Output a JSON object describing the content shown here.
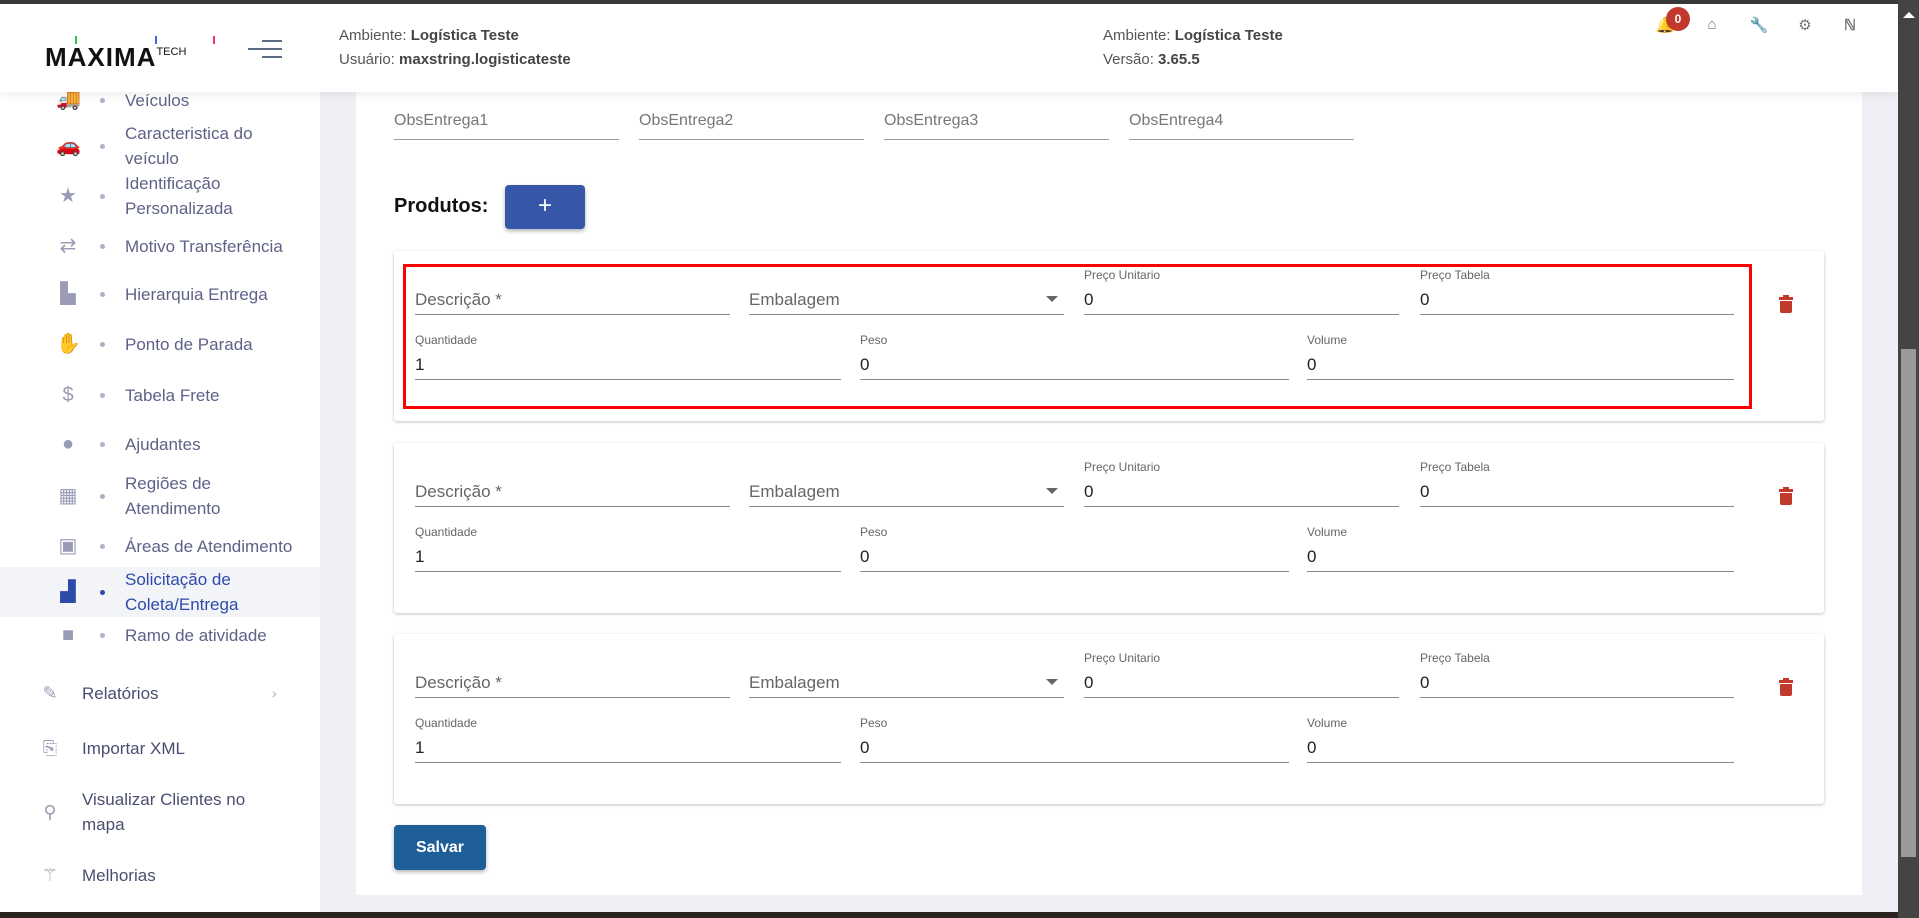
{
  "header": {
    "logo": "MAXIMA",
    "logo_suffix": "TECH",
    "left": {
      "ambiente_label": "Ambiente:",
      "ambiente": "Logística Teste",
      "usuario_label": "Usuário:",
      "usuario": "maxstring.logisticateste"
    },
    "right": {
      "ambiente_label": "Ambiente:",
      "ambiente": "Logística Teste",
      "versao_label": "Versão:",
      "versao": "3.65.5"
    },
    "notifications_count": "0",
    "icons": [
      "bell-icon",
      "home-icon",
      "wrench-icon",
      "gear-icon",
      "logo-n-icon"
    ]
  },
  "sidebar": {
    "subitems": [
      {
        "label": "Veículos",
        "icon": "truck-icon"
      },
      {
        "label": "Caracteristica do veículo",
        "icon": "car-icon"
      },
      {
        "label": "Identificação Personalizada",
        "icon": "star-icon"
      },
      {
        "label": "Motivo Transferência",
        "icon": "transfer-icon"
      },
      {
        "label": "Hierarquia Entrega",
        "icon": "dolly-icon"
      },
      {
        "label": "Ponto de Parada",
        "icon": "hand-icon"
      },
      {
        "label": "Tabela Frete",
        "icon": "money-icon"
      },
      {
        "label": "Ajudantes",
        "icon": "user-icon"
      },
      {
        "label": "Regiões de Atendimento",
        "icon": "map-icon"
      },
      {
        "label": "Áreas de Atendimento",
        "icon": "area-icon"
      },
      {
        "label": "Solicitação de Coleta/Entrega",
        "icon": "pallet-icon",
        "active": true
      },
      {
        "label": "Ramo de atividade",
        "icon": "briefcase-icon"
      }
    ],
    "items": [
      {
        "label": "Relatórios",
        "icon": "edit-icon",
        "has_children": true
      },
      {
        "label": "Importar XML",
        "icon": "file-code-icon"
      },
      {
        "label": "Visualizar Clientes no mapa",
        "icon": "pin-icon"
      },
      {
        "label": "Melhorias",
        "icon": "magic-wand-icon"
      }
    ]
  },
  "form": {
    "obs_fields": [
      {
        "placeholder": "ObsEntrega1"
      },
      {
        "placeholder": "ObsEntrega2"
      },
      {
        "placeholder": "ObsEntrega3"
      },
      {
        "placeholder": "ObsEntrega4"
      }
    ],
    "produtos_label": "Produtos:",
    "add_label": "+",
    "products": [
      {
        "descricao_placeholder": "Descrição *",
        "embalagem_placeholder": "Embalagem",
        "preco_unitario_label": "Preço Unitario",
        "preco_unitario": "0",
        "preco_tabela_label": "Preço Tabela",
        "preco_tabela": "0",
        "quantidade_label": "Quantidade",
        "quantidade": "1",
        "peso_label": "Peso",
        "peso": "0",
        "volume_label": "Volume",
        "volume": "0",
        "highlighted": true
      },
      {
        "descricao_placeholder": "Descrição *",
        "embalagem_placeholder": "Embalagem",
        "preco_unitario_label": "Preço Unitario",
        "preco_unitario": "0",
        "preco_tabela_label": "Preço Tabela",
        "preco_tabela": "0",
        "quantidade_label": "Quantidade",
        "quantidade": "1",
        "peso_label": "Peso",
        "peso": "0",
        "volume_label": "Volume",
        "volume": "0"
      },
      {
        "descricao_placeholder": "Descrição *",
        "embalagem_placeholder": "Embalagem",
        "preco_unitario_label": "Preço Unitario",
        "preco_unitario": "0",
        "preco_tabela_label": "Preço Tabela",
        "preco_tabela": "0",
        "quantidade_label": "Quantidade",
        "quantidade": "1",
        "peso_label": "Peso",
        "peso": "0",
        "volume_label": "Volume",
        "volume": "0"
      }
    ],
    "save_label": "Salvar"
  },
  "colors": {
    "primary": "#3657a8",
    "save": "#1f5f99",
    "danger": "#c0392b",
    "highlight": "#ff0000",
    "sidebar_active": "#2d4aa8"
  }
}
